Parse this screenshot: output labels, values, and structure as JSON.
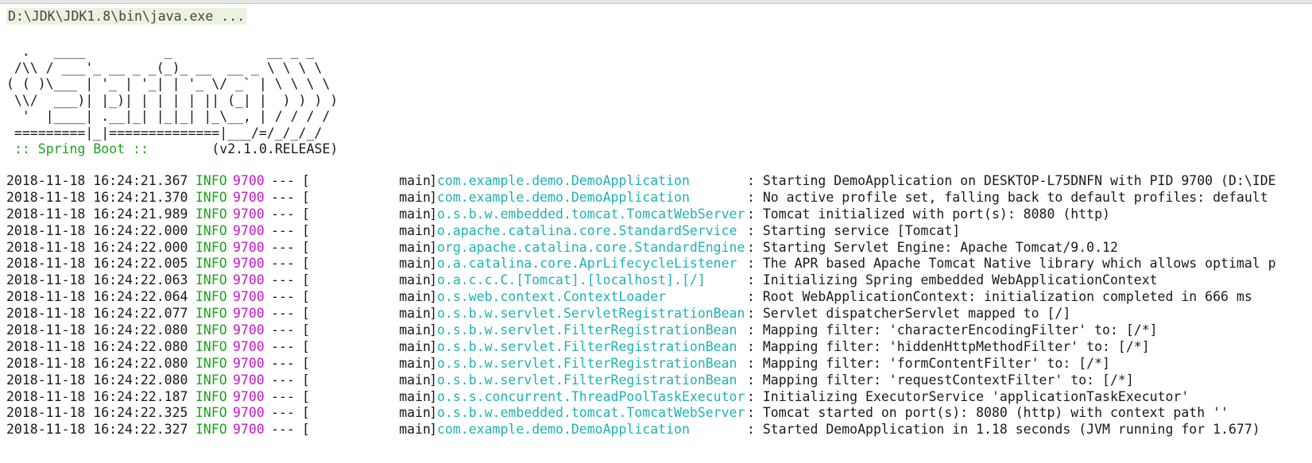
{
  "window": {
    "command": "D:\\JDK\\JDK1.8\\bin\\java.exe ..."
  },
  "banner": {
    "ascii_art": "  .   ____          _            __ _ _\n /\\\\ / ___'_ __ _ _(_)_ __  __ _ \\ \\ \\ \\\n( ( )\\___ | '_ | '_| | '_ \\/ _` | \\ \\ \\ \\\n \\\\/  ___)| |_)| | | | | || (_| |  ) ) ) )\n  '  |____| .__|_| |_|_| |_\\__, | / / / /\n =========|_|==============|___/=/_/_/_/",
    "spring_label": ":: Spring Boot ::",
    "version": "(v2.1.0.RELEASE)"
  },
  "log": {
    "separator": "---",
    "bracket_open": "[",
    "bracket_close": "]",
    "rows": [
      {
        "ts": "2018-11-18 16:24:21.367",
        "level": "INFO",
        "pid": "9700",
        "thread": "main",
        "logger": "com.example.demo.DemoApplication",
        "msg": ": Starting DemoApplication on DESKTOP-L75DNFN with PID 9700 (D:\\IDE"
      },
      {
        "ts": "2018-11-18 16:24:21.370",
        "level": "INFO",
        "pid": "9700",
        "thread": "main",
        "logger": "com.example.demo.DemoApplication",
        "msg": ": No active profile set, falling back to default profiles: default"
      },
      {
        "ts": "2018-11-18 16:24:21.989",
        "level": "INFO",
        "pid": "9700",
        "thread": "main",
        "logger": "o.s.b.w.embedded.tomcat.TomcatWebServer",
        "msg": ": Tomcat initialized with port(s): 8080 (http)"
      },
      {
        "ts": "2018-11-18 16:24:22.000",
        "level": "INFO",
        "pid": "9700",
        "thread": "main",
        "logger": "o.apache.catalina.core.StandardService",
        "msg": ": Starting service [Tomcat]"
      },
      {
        "ts": "2018-11-18 16:24:22.000",
        "level": "INFO",
        "pid": "9700",
        "thread": "main",
        "logger": "org.apache.catalina.core.StandardEngine",
        "msg": ": Starting Servlet Engine: Apache Tomcat/9.0.12"
      },
      {
        "ts": "2018-11-18 16:24:22.005",
        "level": "INFO",
        "pid": "9700",
        "thread": "main",
        "logger": "o.a.catalina.core.AprLifecycleListener",
        "msg": ": The APR based Apache Tomcat Native library which allows optimal p"
      },
      {
        "ts": "2018-11-18 16:24:22.063",
        "level": "INFO",
        "pid": "9700",
        "thread": "main",
        "logger": "o.a.c.c.C.[Tomcat].[localhost].[/]",
        "msg": ": Initializing Spring embedded WebApplicationContext"
      },
      {
        "ts": "2018-11-18 16:24:22.064",
        "level": "INFO",
        "pid": "9700",
        "thread": "main",
        "logger": "o.s.web.context.ContextLoader",
        "msg": ": Root WebApplicationContext: initialization completed in 666 ms"
      },
      {
        "ts": "2018-11-18 16:24:22.077",
        "level": "INFO",
        "pid": "9700",
        "thread": "main",
        "logger": "o.s.b.w.servlet.ServletRegistrationBean",
        "msg": ": Servlet dispatcherServlet mapped to [/]"
      },
      {
        "ts": "2018-11-18 16:24:22.080",
        "level": "INFO",
        "pid": "9700",
        "thread": "main",
        "logger": "o.s.b.w.servlet.FilterRegistrationBean",
        "msg": ": Mapping filter: 'characterEncodingFilter' to: [/*]"
      },
      {
        "ts": "2018-11-18 16:24:22.080",
        "level": "INFO",
        "pid": "9700",
        "thread": "main",
        "logger": "o.s.b.w.servlet.FilterRegistrationBean",
        "msg": ": Mapping filter: 'hiddenHttpMethodFilter' to: [/*]"
      },
      {
        "ts": "2018-11-18 16:24:22.080",
        "level": "INFO",
        "pid": "9700",
        "thread": "main",
        "logger": "o.s.b.w.servlet.FilterRegistrationBean",
        "msg": ": Mapping filter: 'formContentFilter' to: [/*]"
      },
      {
        "ts": "2018-11-18 16:24:22.080",
        "level": "INFO",
        "pid": "9700",
        "thread": "main",
        "logger": "o.s.b.w.servlet.FilterRegistrationBean",
        "msg": ": Mapping filter: 'requestContextFilter' to: [/*]"
      },
      {
        "ts": "2018-11-18 16:24:22.187",
        "level": "INFO",
        "pid": "9700",
        "thread": "main",
        "logger": "o.s.s.concurrent.ThreadPoolTaskExecutor",
        "msg": ": Initializing ExecutorService 'applicationTaskExecutor'"
      },
      {
        "ts": "2018-11-18 16:24:22.325",
        "level": "INFO",
        "pid": "9700",
        "thread": "main",
        "logger": "o.s.b.w.embedded.tomcat.TomcatWebServer",
        "msg": ": Tomcat started on port(s): 8080 (http) with context path ''"
      },
      {
        "ts": "2018-11-18 16:24:22.327",
        "level": "INFO",
        "pid": "9700",
        "thread": "main",
        "logger": "com.example.demo.DemoApplication",
        "msg": ": Started DemoApplication in 1.18 seconds (JVM running for 1.677)"
      }
    ]
  },
  "colors": {
    "level": "#1ea31e",
    "pid": "#c61bc6",
    "logger": "#1fb2b2",
    "spring_label": "#1ea31e",
    "text": "#1a1a1a"
  }
}
